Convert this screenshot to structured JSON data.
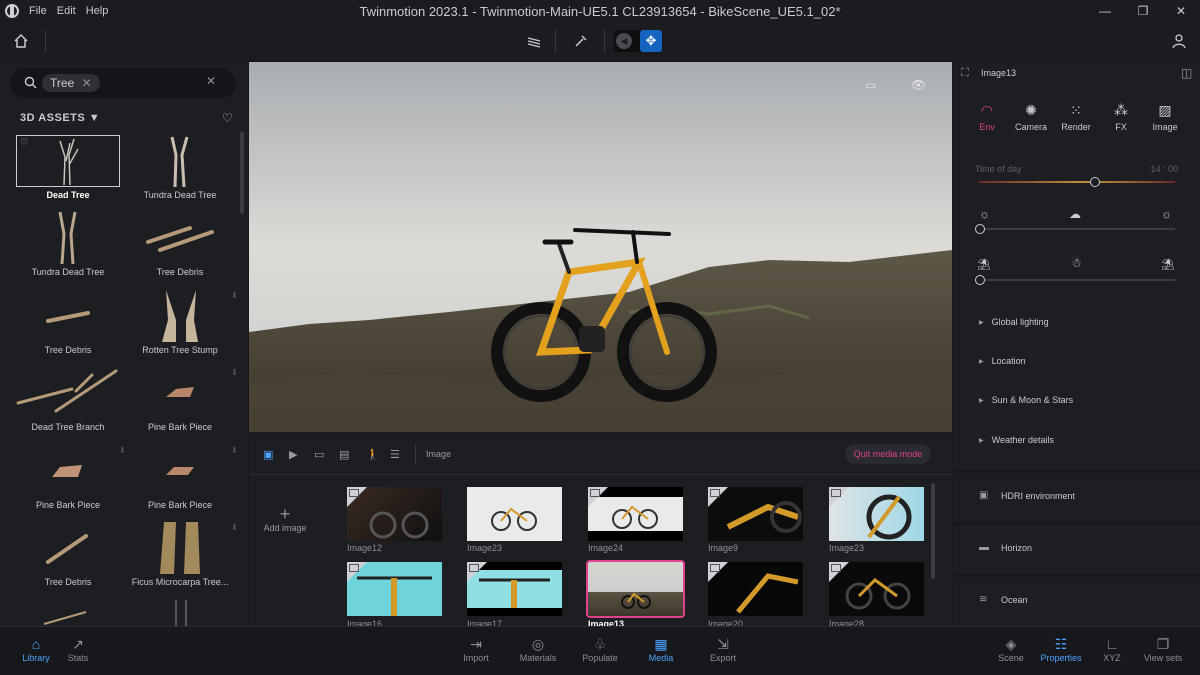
{
  "window": {
    "title": "Twinmotion 2023.1 - Twinmotion-Main-UE5.1 CL23913654 - BikeScene_UE5.1_02*",
    "menu": [
      "File",
      "Edit",
      "Help"
    ],
    "minimize": "—",
    "maximize": "❐",
    "close": "✕"
  },
  "library": {
    "search_tag": "Tree",
    "section_title": "3D ASSETS",
    "assets": [
      {
        "label": "Dead Tree",
        "selected": true
      },
      {
        "label": "Tundra Dead Tree"
      },
      {
        "label": "Tundra Dead Tree"
      },
      {
        "label": "Tree Debris"
      },
      {
        "label": "Tree Debris"
      },
      {
        "label": "Rotten Tree Stump"
      },
      {
        "label": "Dead Tree Branch"
      },
      {
        "label": "Pine Bark Piece"
      },
      {
        "label": "Pine Bark Piece"
      },
      {
        "label": "Pine Bark Piece"
      },
      {
        "label": "Tree Debris"
      },
      {
        "label": "Ficus Microcarpa Tree..."
      }
    ]
  },
  "media": {
    "mode_label": "Image",
    "quit_label": "Quit media mode",
    "add_label": "Add image",
    "images": [
      {
        "label": "Image12"
      },
      {
        "label": "Image23"
      },
      {
        "label": "Image24"
      },
      {
        "label": "Image9"
      },
      {
        "label": "Image23"
      },
      {
        "label": "Image16"
      },
      {
        "label": "Image17"
      },
      {
        "label": "Image13",
        "selected": true
      },
      {
        "label": "Image20"
      },
      {
        "label": "Image28"
      }
    ]
  },
  "properties": {
    "object_name": "Image13",
    "tabs": [
      {
        "label": "Env",
        "active": true
      },
      {
        "label": "Camera"
      },
      {
        "label": "Render"
      },
      {
        "label": "FX"
      },
      {
        "label": "Image"
      }
    ],
    "time_label": "Time of day",
    "time_value": "14 : 00",
    "time_slider": 0.59,
    "sections": [
      "Global lighting",
      "Location",
      "Sun & Moon & Stars",
      "Weather details"
    ],
    "blocks": [
      "HDRI environment",
      "Horizon",
      "Ocean"
    ]
  },
  "bottom": {
    "left": [
      {
        "label": "Library",
        "active": true
      },
      {
        "label": "Stats"
      }
    ],
    "center": [
      {
        "label": "Import"
      },
      {
        "label": "Materials"
      },
      {
        "label": "Populate"
      },
      {
        "label": "Media",
        "active": true
      },
      {
        "label": "Export"
      }
    ],
    "right": [
      {
        "label": "Scene"
      },
      {
        "label": "Properties",
        "active": true
      },
      {
        "label": "XYZ"
      },
      {
        "label": "View sets"
      }
    ]
  },
  "colors": {
    "accent_pink": "#e0418f",
    "accent_blue": "#4da3ff",
    "move_tool": "#1565c0"
  }
}
